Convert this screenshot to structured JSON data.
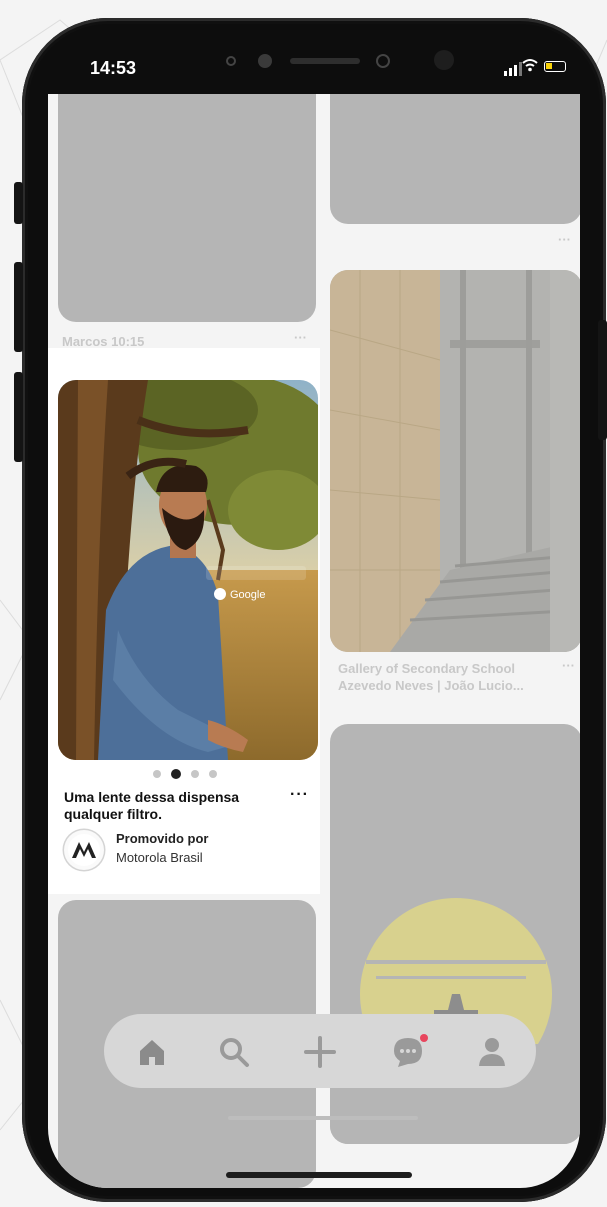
{
  "status_bar": {
    "time": "14:53"
  },
  "feed": {
    "left_caption_1": "Marcos 10:15",
    "right_caption": "Gallery of Secondary School Azevedo Neves | João Lucio...",
    "more_label": "···"
  },
  "promo": {
    "overlay_text": "Google",
    "title": "Uma lente dessa dispensa qualquer filtro.",
    "promoted_label": "Promovido por",
    "advertiser": "Motorola Brasil",
    "more_label": "···",
    "pager": {
      "total": 4,
      "active": 2
    }
  },
  "bottom_nav": {
    "items": [
      "home-icon",
      "search-icon",
      "plus-icon",
      "messages-icon",
      "profile-icon"
    ],
    "notification_badge": true
  },
  "colors": {
    "scrim": "#b5b5b5",
    "promo_bg": "#ffffff",
    "badge": "#e8465e",
    "battery": "#f7d20a"
  }
}
